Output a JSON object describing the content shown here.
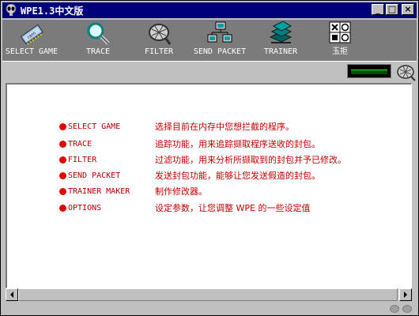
{
  "window": {
    "title": "WPE1.3中文版"
  },
  "titlebar_buttons": {
    "minimize": "_",
    "maximize": "□",
    "close": "×"
  },
  "toolbar": {
    "items": [
      {
        "label": "SELECT GAME",
        "icon": "ram-chip-icon"
      },
      {
        "label": "TRACE",
        "icon": "magnifier-icon"
      },
      {
        "label": "FILTER",
        "icon": "filter-net-icon"
      },
      {
        "label": "SEND PACKET",
        "icon": "network-computers-icon"
      },
      {
        "label": "TRAINER",
        "icon": "trainer-boxes-icon"
      },
      {
        "label": "玉拒",
        "icon": "options-grid-icon"
      }
    ]
  },
  "menu_help": {
    "rows": [
      {
        "command": "SELECT GAME",
        "description": "选择目前在内存中您想拦截的程序。"
      },
      {
        "command": "TRACE",
        "description": "追踪功能，用来追踪撷取程序送收的封包。"
      },
      {
        "command": "FILTER",
        "description": "过滤功能，用来分析所撷取到的封包并予已修改。"
      },
      {
        "command": "SEND PACKET",
        "description": "发送封包功能，能够让您发送假造的封包。"
      },
      {
        "command": "TRAINER MAKER",
        "description": "制作修改器。"
      },
      {
        "command": "OPTIONS",
        "description": "设定参数，让您调整 WPE 的一些设定值"
      }
    ]
  },
  "colors": {
    "titlebar": "#00007b",
    "toolbar": "#7b7b7b",
    "accent_red": "#e00000"
  }
}
